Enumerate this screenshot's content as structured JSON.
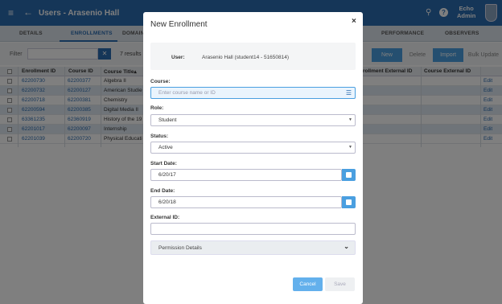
{
  "header": {
    "title": "Users - Arasenio Hall",
    "user_line1": "Echo",
    "user_line2": "Admin"
  },
  "tabs": [
    {
      "label": "DETAILS"
    },
    {
      "label": "ENROLLMENTS"
    },
    {
      "label": "DOMAIN"
    },
    {
      "label": "PERFORMANCE"
    },
    {
      "label": "OBSERVERS"
    }
  ],
  "toolbar": {
    "filter_label": "Filter",
    "filter_value": "",
    "results": "7 results",
    "new_label": "New",
    "delete_label": "Delete",
    "import_label": "Import",
    "bulk_label": "Bulk Update"
  },
  "grid": {
    "columns": [
      "Enrollment ID",
      "Course ID",
      "Course Title",
      "rollment External ID",
      "Course External ID"
    ],
    "sort_indicator": "▴",
    "edit_label": "Edit",
    "rows": [
      {
        "enrollment_id": "62200730",
        "course_id": "62200377",
        "course_title": "Algebra II"
      },
      {
        "enrollment_id": "62200732",
        "course_id": "62200127",
        "course_title": "American Studie"
      },
      {
        "enrollment_id": "62200718",
        "course_id": "62200381",
        "course_title": "Chemistry"
      },
      {
        "enrollment_id": "62200594",
        "course_id": "62200385",
        "course_title": "Digital Media II"
      },
      {
        "enrollment_id": "63361235",
        "course_id": "62360919",
        "course_title": "History of the 19"
      },
      {
        "enrollment_id": "62201017",
        "course_id": "62200097",
        "course_title": "Internship"
      },
      {
        "enrollment_id": "62201039",
        "course_id": "62200720",
        "course_title": "Physical Educati"
      }
    ]
  },
  "modal": {
    "title": "New Enrollment",
    "close": "×",
    "user_label": "User:",
    "user_value": "Arasenio Hall (student14 - 51650814)",
    "course_label": "Course:",
    "course_placeholder": "Enter course name or ID",
    "role_label": "Role:",
    "role_value": "Student",
    "status_label": "Status:",
    "status_value": "Active",
    "start_label": "Start Date:",
    "start_value": "6/20/17",
    "end_label": "End Date:",
    "end_value": "6/20/18",
    "external_label": "External ID:",
    "external_value": "",
    "permission_label": "Permission Details",
    "cancel_label": "Cancel",
    "save_label": "Save"
  }
}
